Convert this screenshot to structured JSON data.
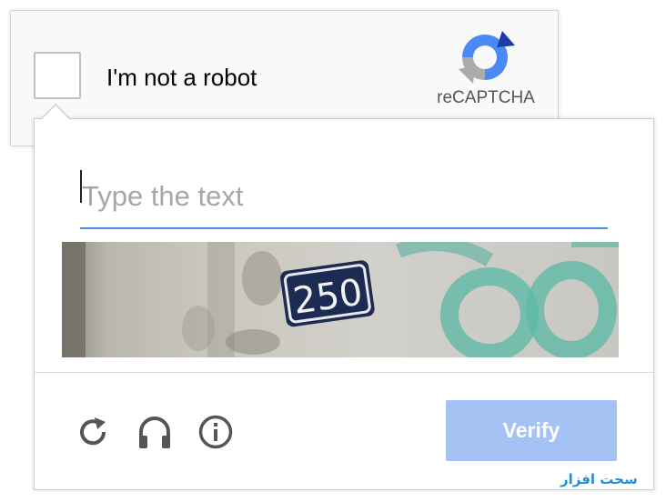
{
  "anchor": {
    "label": "I'm not a robot",
    "logo_text": "reCAPTCHA"
  },
  "challenge": {
    "input_placeholder": "Type the text",
    "captcha_text": "250",
    "verify_label": "Verify"
  },
  "tools": [
    {
      "icon": "reload-icon"
    },
    {
      "icon": "headphones-icon"
    },
    {
      "icon": "info-icon"
    }
  ],
  "watermark": {
    "text": "سحت افزار"
  },
  "colors": {
    "accent_blue": "#4a90e2",
    "verify_bg": "#a4c2f4",
    "icon_gray": "#555555"
  }
}
